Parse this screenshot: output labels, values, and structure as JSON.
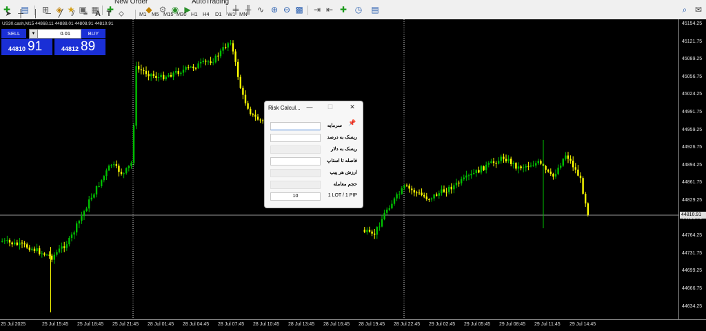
{
  "toolbar": {
    "new_order": "New Order",
    "autotrading": "AutoTrading",
    "timeframes": [
      "M1",
      "M5",
      "M15",
      "M30",
      "H1",
      "H4",
      "D1",
      "W1",
      "MN"
    ],
    "text_tool": "A",
    "label_tool": "T"
  },
  "chart": {
    "info": "US30.cash,M15  44868.11 44888.01 44808.91 44810.91",
    "bull_color": "#00c000",
    "bear_color": "#ffff00",
    "price_ticks": [
      "45154.25",
      "45121.75",
      "45089.25",
      "45056.75",
      "45024.25",
      "44991.75",
      "44959.25",
      "44926.75",
      "44894.25",
      "44861.75",
      "44829.25",
      "44796.75",
      "44764.25",
      "44731.75",
      "44699.25",
      "44666.75",
      "44634.25"
    ],
    "current_price": "44810.91",
    "time_ticks": [
      "25 Jul 2025",
      "25 Jul 15:45",
      "25 Jul 18:45",
      "25 Jul 21:45",
      "28 Jul 01:45",
      "28 Jul 04:45",
      "28 Jul 07:45",
      "28 Jul 10:45",
      "28 Jul 13:45",
      "28 Jul 16:45",
      "28 Jul 19:45",
      "28 Jul 22:45",
      "29 Jul 02:45",
      "29 Jul 05:45",
      "29 Jul 08:45",
      "29 Jul 11:45",
      "29 Jul 14:45"
    ]
  },
  "one_click": {
    "sell_label": "SELL",
    "buy_label": "BUY",
    "lot": "0.01",
    "sell_prefix": "44810",
    "sell_big": "91",
    "buy_prefix": "44812",
    "buy_big": "89"
  },
  "dialog": {
    "title": "Risk Calcul...",
    "labels": [
      "سرمایه",
      "ریسک به درصد",
      "ریسک به دلار",
      "فاصله تا استاپ",
      "ارزش هر پیپ",
      "حجم معامله"
    ],
    "pip_label": "1 LOT / 1 PIP",
    "pip_value": "10"
  }
}
